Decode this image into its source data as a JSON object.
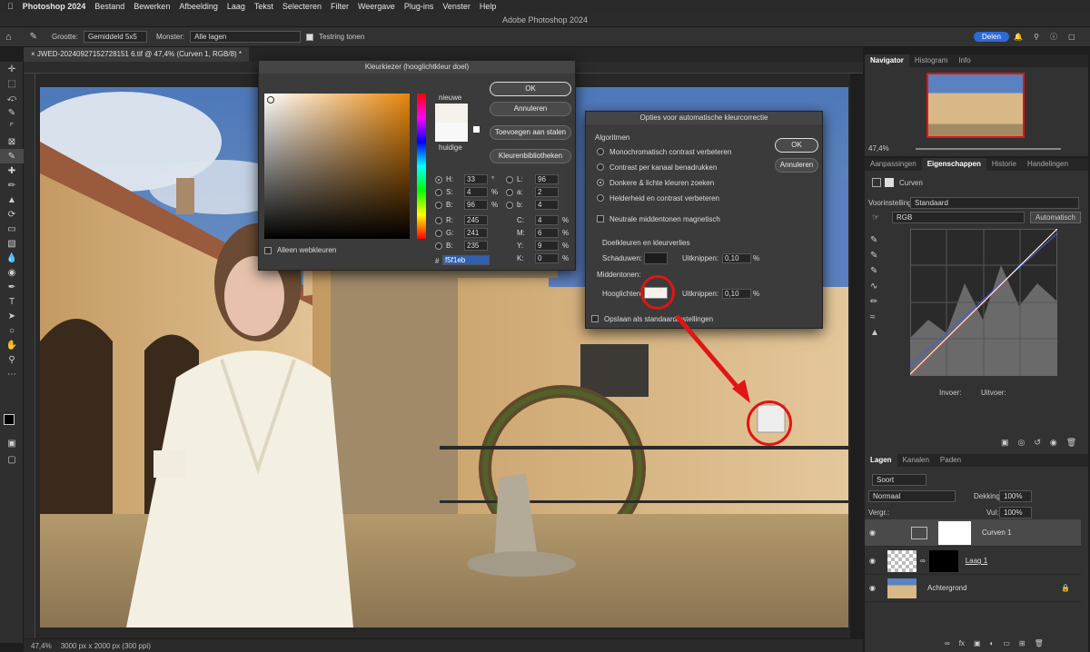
{
  "menubar": {
    "apple": "",
    "app": "Photoshop 2024",
    "items": [
      "Bestand",
      "Bewerken",
      "Afbeelding",
      "Laag",
      "Tekst",
      "Selecteren",
      "Filter",
      "Weergave",
      "Plug-ins",
      "Venster",
      "Help"
    ]
  },
  "window_title": "Adobe Photoshop 2024",
  "options": {
    "size_label": "Grootte:",
    "size_value": "Gemiddeld 5x5",
    "sample_label": "Monster:",
    "sample_value": "Alle lagen",
    "ring_label": "Testring tonen",
    "share": "Delen"
  },
  "doc_tab": "JWED-20240927152728151 6.tif @ 47,4% (Curven 1, RGB/8) *",
  "status": {
    "zoom": "47,4%",
    "info": "3000 px x 2000 px (300 ppi)"
  },
  "picker": {
    "title": "Kleurkiezer (hooglichtkleur doel)",
    "new_label": "nieuwe",
    "current_label": "huidige",
    "ok": "OK",
    "cancel": "Annuleren",
    "add_swatch": "Toevoegen aan stalen",
    "libraries": "Kleurenbibliotheken",
    "web_only": "Alleen webkleuren",
    "H": "33",
    "S": "4",
    "B": "96",
    "R": "245",
    "G": "241",
    "Bv": "235",
    "L": "96",
    "a": "2",
    "b": "4",
    "C": "4",
    "M": "6",
    "Y": "9",
    "K": "0",
    "hex": "f5f1eb",
    "unit_deg": "°",
    "unit_pct": "%",
    "hash": "#",
    "labels": {
      "H": "H:",
      "S": "S:",
      "B": "B:",
      "R": "R:",
      "G": "G:",
      "Bv": "B:",
      "L": "L:",
      "a": "a:",
      "b": "b:",
      "C": "C:",
      "M": "M:",
      "Y": "Y:",
      "K": "K:"
    },
    "new_color": "#f5f1eb"
  },
  "auto": {
    "title": "Opties voor automatische kleurcorrectie",
    "algorithms": "Algoritmen",
    "opt1": "Monochromatisch contrast verbeteren",
    "opt2": "Contrast per kanaal benadrukken",
    "opt3": "Donkere & lichte kleuren zoeken",
    "opt4": "Helderheid en contrast verbeteren",
    "neutral": "Neutrale middentonen magnetisch",
    "targets": "Doelkleuren en kleurverlies",
    "shadows": "Schaduwen:",
    "midtones": "Middentonen:",
    "highlights": "Hooglichten:",
    "clip": "Uitknippen:",
    "clip_sh": "0,10",
    "clip_hl": "0,10",
    "pct": "%",
    "save": "Opslaan als standaardinstellingen",
    "ok": "OK",
    "cancel": "Annuleren"
  },
  "navigator": {
    "tabs": [
      "Navigator",
      "Histogram",
      "Info"
    ],
    "zoom": "47,4%"
  },
  "properties": {
    "tabs": [
      "Aanpassingen",
      "Eigenschappen",
      "Historie",
      "Handelingen"
    ],
    "type": "Curven",
    "preset_label": "Voorinstelling:",
    "preset": "Standaard",
    "channel": "RGB",
    "auto": "Automatisch",
    "input": "Invoer:",
    "output": "Uitvoer:"
  },
  "layers": {
    "tabs": [
      "Lagen",
      "Kanalen",
      "Paden"
    ],
    "kind": "Soort",
    "blend": "Normaal",
    "opacity_label": "Dekking:",
    "opacity": "100%",
    "lock_label": "Vergr.:",
    "fill_label": "Vul:",
    "fill": "100%",
    "items": [
      {
        "name": "Curven 1"
      },
      {
        "name": "Laag 1"
      },
      {
        "name": "Achtergrond"
      }
    ]
  },
  "tools": [
    "move",
    "marquee",
    "lasso",
    "quick-select",
    "crop",
    "frame",
    "eyedropper",
    "healing",
    "brush",
    "stamp",
    "history-brush",
    "eraser",
    "gradient",
    "blur",
    "dodge",
    "pen",
    "text",
    "path-select",
    "shape",
    "hand",
    "zoom",
    "more"
  ]
}
